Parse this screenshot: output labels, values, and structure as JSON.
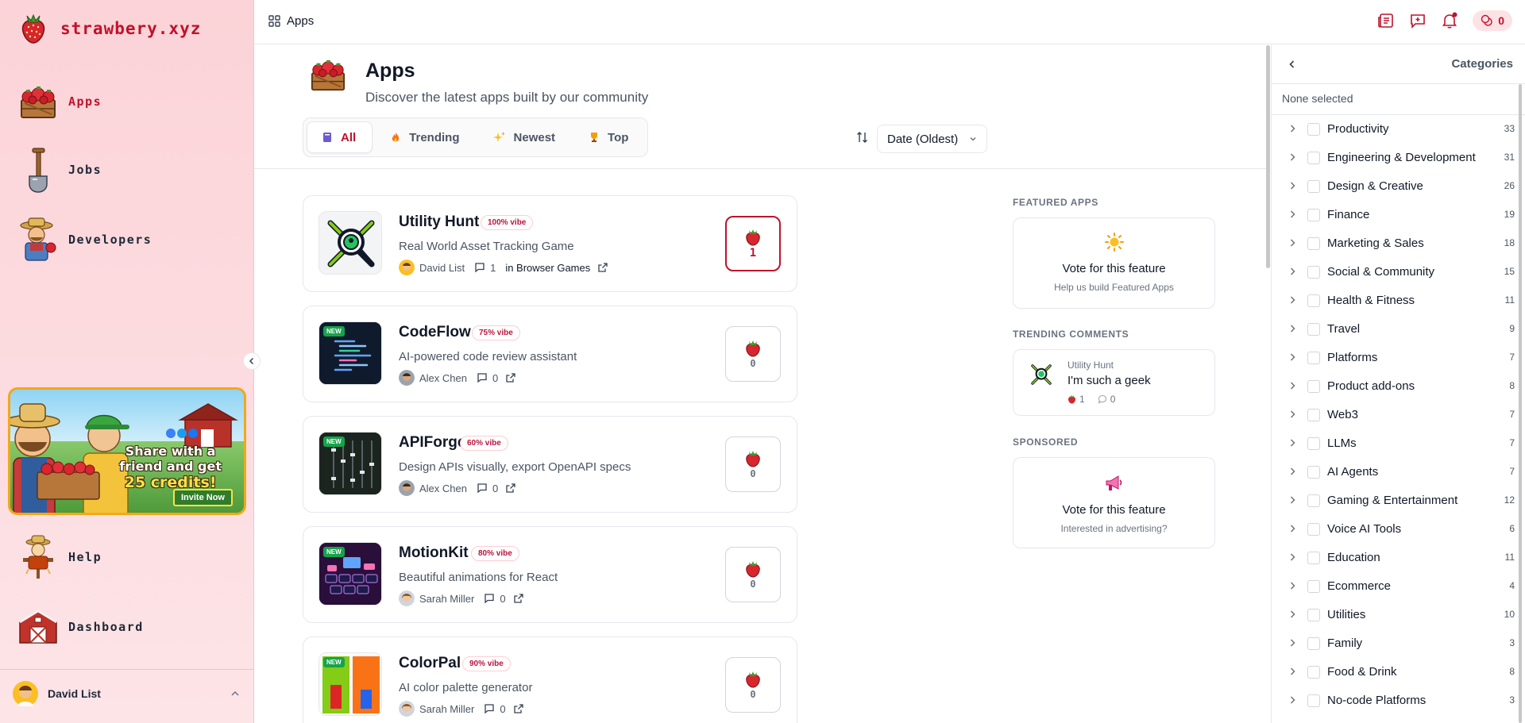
{
  "app": {
    "brand": "strawbery.xyz"
  },
  "sidebar": {
    "nav": [
      {
        "label": "Apps",
        "icon": "strawberry-crate-icon"
      },
      {
        "label": "Jobs",
        "icon": "shovel-icon"
      },
      {
        "label": "Developers",
        "icon": "farmer-icon"
      },
      {
        "label": "Help",
        "icon": "scarecrow-icon"
      },
      {
        "label": "Dashboard",
        "icon": "barn-icon"
      }
    ],
    "banner": {
      "line1": "Share with a",
      "line2": "friend and get",
      "line3": "25 credits!",
      "cta": "Invite Now"
    },
    "user": {
      "name": "David List"
    }
  },
  "topbar": {
    "breadcrumb": "Apps",
    "credits": "0"
  },
  "header": {
    "title": "Apps",
    "subtitle": "Discover the latest apps built by our community"
  },
  "tabs": [
    {
      "label": "All",
      "icon": "book-icon"
    },
    {
      "label": "Trending",
      "icon": "fire-icon"
    },
    {
      "label": "Newest",
      "icon": "sparkles-icon"
    },
    {
      "label": "Top",
      "icon": "trophy-icon"
    }
  ],
  "sort": {
    "selected": "Date (Oldest)"
  },
  "apps": [
    {
      "name": "Utility Hunt",
      "vibe": "100% vibe",
      "desc": "Real World Asset Tracking Game",
      "author": "David List",
      "comments": "1",
      "category": "in Browser Games",
      "votes": "1",
      "is_new": false
    },
    {
      "name": "CodeFlow",
      "vibe": "75% vibe",
      "desc": "AI-powered code review assistant",
      "author": "Alex Chen",
      "comments": "0",
      "category": "",
      "votes": "0",
      "is_new": true
    },
    {
      "name": "APIForge",
      "vibe": "60% vibe",
      "desc": "Design APIs visually, export OpenAPI specs",
      "author": "Alex Chen",
      "comments": "0",
      "category": "",
      "votes": "0",
      "is_new": true
    },
    {
      "name": "MotionKit",
      "vibe": "80% vibe",
      "desc": "Beautiful animations for React",
      "author": "Sarah Miller",
      "comments": "0",
      "category": "",
      "votes": "0",
      "is_new": true
    },
    {
      "name": "ColorPal",
      "vibe": "90% vibe",
      "desc": "AI color palette generator",
      "author": "Sarah Miller",
      "comments": "0",
      "category": "",
      "votes": "0",
      "is_new": true
    }
  ],
  "new_badge": "NEW",
  "featured": {
    "heading": "FEATURED APPS",
    "title": "Vote for this feature",
    "sub": "Help us build Featured Apps"
  },
  "trending_comments": {
    "heading": "TRENDING COMMENTS",
    "app": "Utility Hunt",
    "text": "I'm such a geek",
    "likes": "1",
    "replies": "0"
  },
  "sponsored": {
    "heading": "SPONSORED",
    "title": "Vote for this feature",
    "sub": "Interested in advertising?"
  },
  "categories": {
    "title": "Categories",
    "none_selected": "None selected",
    "items": [
      {
        "name": "Productivity",
        "count": "33"
      },
      {
        "name": "Engineering & Development",
        "count": "31"
      },
      {
        "name": "Design & Creative",
        "count": "26"
      },
      {
        "name": "Finance",
        "count": "19"
      },
      {
        "name": "Marketing & Sales",
        "count": "18"
      },
      {
        "name": "Social & Community",
        "count": "15"
      },
      {
        "name": "Health & Fitness",
        "count": "11"
      },
      {
        "name": "Travel",
        "count": "9"
      },
      {
        "name": "Platforms",
        "count": "7"
      },
      {
        "name": "Product add-ons",
        "count": "8"
      },
      {
        "name": "Web3",
        "count": "7"
      },
      {
        "name": "LLMs",
        "count": "7"
      },
      {
        "name": "AI Agents",
        "count": "7"
      },
      {
        "name": "Gaming & Entertainment",
        "count": "12"
      },
      {
        "name": "Voice AI Tools",
        "count": "6"
      },
      {
        "name": "Education",
        "count": "11"
      },
      {
        "name": "Ecommerce",
        "count": "4"
      },
      {
        "name": "Utilities",
        "count": "10"
      },
      {
        "name": "Family",
        "count": "3"
      },
      {
        "name": "Food & Drink",
        "count": "8"
      },
      {
        "name": "No-code Platforms",
        "count": "3"
      }
    ]
  },
  "colors": {
    "brand": "#c0122b",
    "sidebar_bg": "#fbd3d8",
    "new_badge": "#16a34a"
  }
}
